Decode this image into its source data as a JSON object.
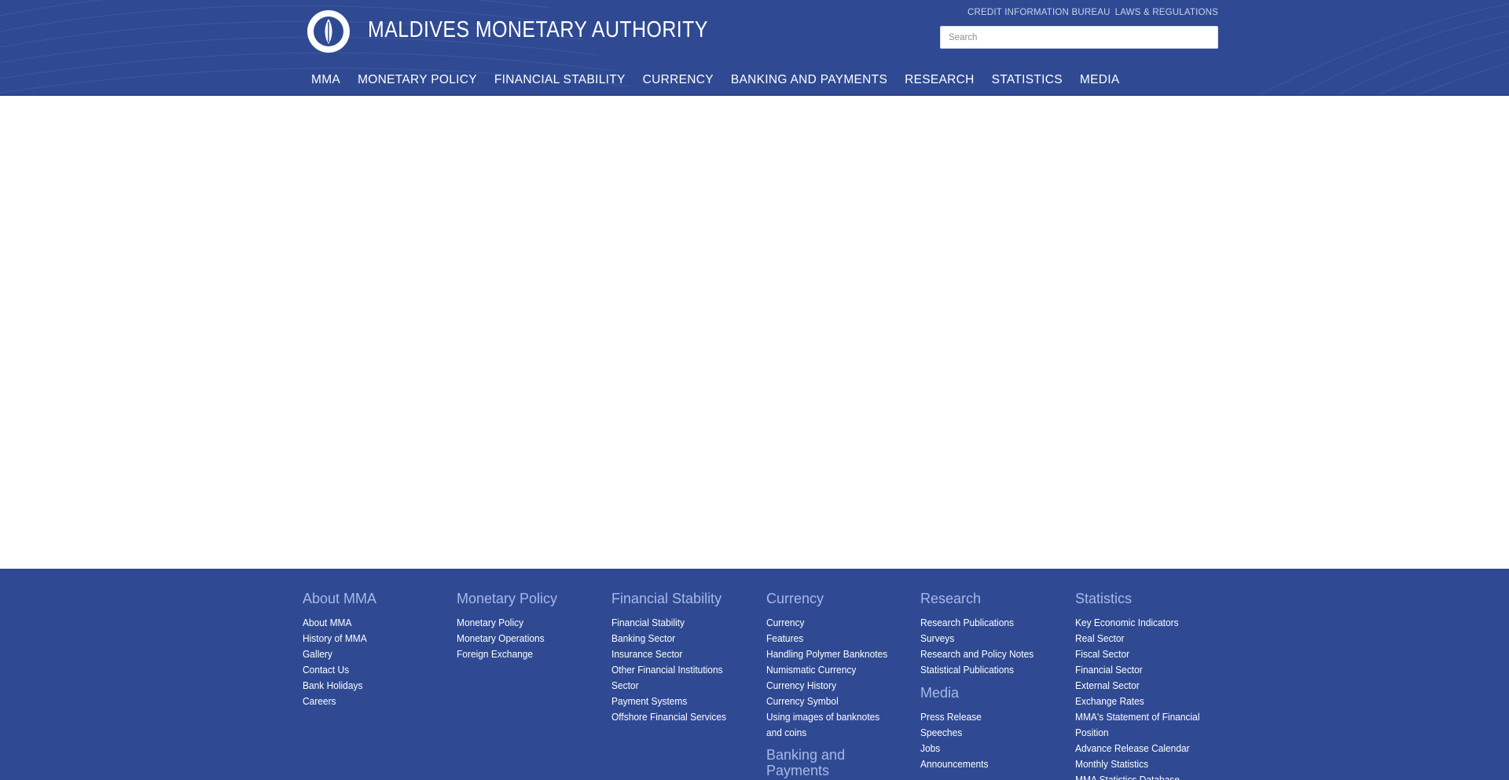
{
  "header": {
    "site_title": "MALDIVES MONETARY AUTHORITY",
    "logo_icon": "mma-seal-logo",
    "util_links": [
      "CREDIT INFORMATION BUREAU",
      "LAWS & REGULATIONS"
    ],
    "search_placeholder": "Search",
    "nav": [
      "MMA",
      "MONETARY POLICY",
      "FINANCIAL STABILITY",
      "CURRENCY",
      "BANKING AND PAYMENTS",
      "RESEARCH",
      "STATISTICS",
      "MEDIA"
    ]
  },
  "colors": {
    "header_bg": "#2f4a93",
    "footer_bg": "#2f4a93",
    "footer_heading": "#a8b8e6",
    "link": "#ffffff"
  },
  "footer": {
    "columns": [
      {
        "heading": "About MMA",
        "items": [
          "About MMA",
          "History of MMA",
          "Gallery",
          "Contact Us",
          "Bank Holidays",
          "Careers"
        ]
      },
      {
        "heading": "Monetary Policy",
        "items": [
          "Monetary Policy",
          "Monetary Operations",
          "Foreign Exchange"
        ]
      },
      {
        "heading": "Financial Stability",
        "items": [
          "Financial Stability",
          "Banking Sector",
          "Insurance Sector",
          "Other Financial Institutions Sector",
          "Payment Systems",
          "Offshore Financial Services"
        ]
      },
      {
        "heading": "Currency",
        "items": [
          "Currency",
          "Features",
          "Handling Polymer Banknotes",
          "Numismatic Currency",
          "Currency History",
          "Currency Symbol",
          "Using images of banknotes and coins"
        ],
        "sub_heading": "Banking and Payments"
      },
      {
        "heading": "Research",
        "items": [
          "Research Publications",
          "Surveys",
          "Research and Policy Notes",
          "Statistical Publications"
        ],
        "sub_heading": "Media",
        "sub_items": [
          "Press Release",
          "Speeches",
          "Jobs",
          "Announcements"
        ]
      },
      {
        "heading": "Statistics",
        "items": [
          "Key Economic Indicators",
          "Real Sector",
          "Fiscal Sector",
          "Financial Sector",
          "External Sector",
          "Exchange Rates",
          "MMA's Statement of Financial Position",
          "Advance Release Calendar",
          "Monthly Statistics",
          "MMA Statistics Database"
        ]
      }
    ]
  }
}
